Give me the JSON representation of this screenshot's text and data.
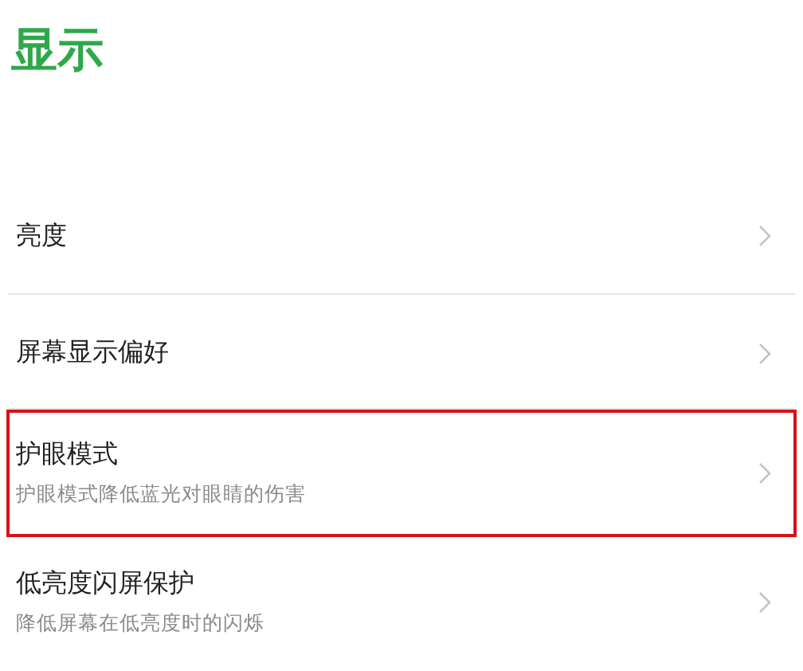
{
  "title": "显示",
  "items": [
    {
      "label": "亮度",
      "highlighted": false
    },
    {
      "label": "屏幕显示偏好",
      "highlighted": false
    },
    {
      "label": "护眼模式",
      "subtitle": "护眼模式降低蓝光对眼睛的伤害",
      "highlighted": true
    },
    {
      "label": "低亮度闪屏保护",
      "subtitle": "降低屏幕在低亮度时的闪烁",
      "highlighted": false
    }
  ]
}
